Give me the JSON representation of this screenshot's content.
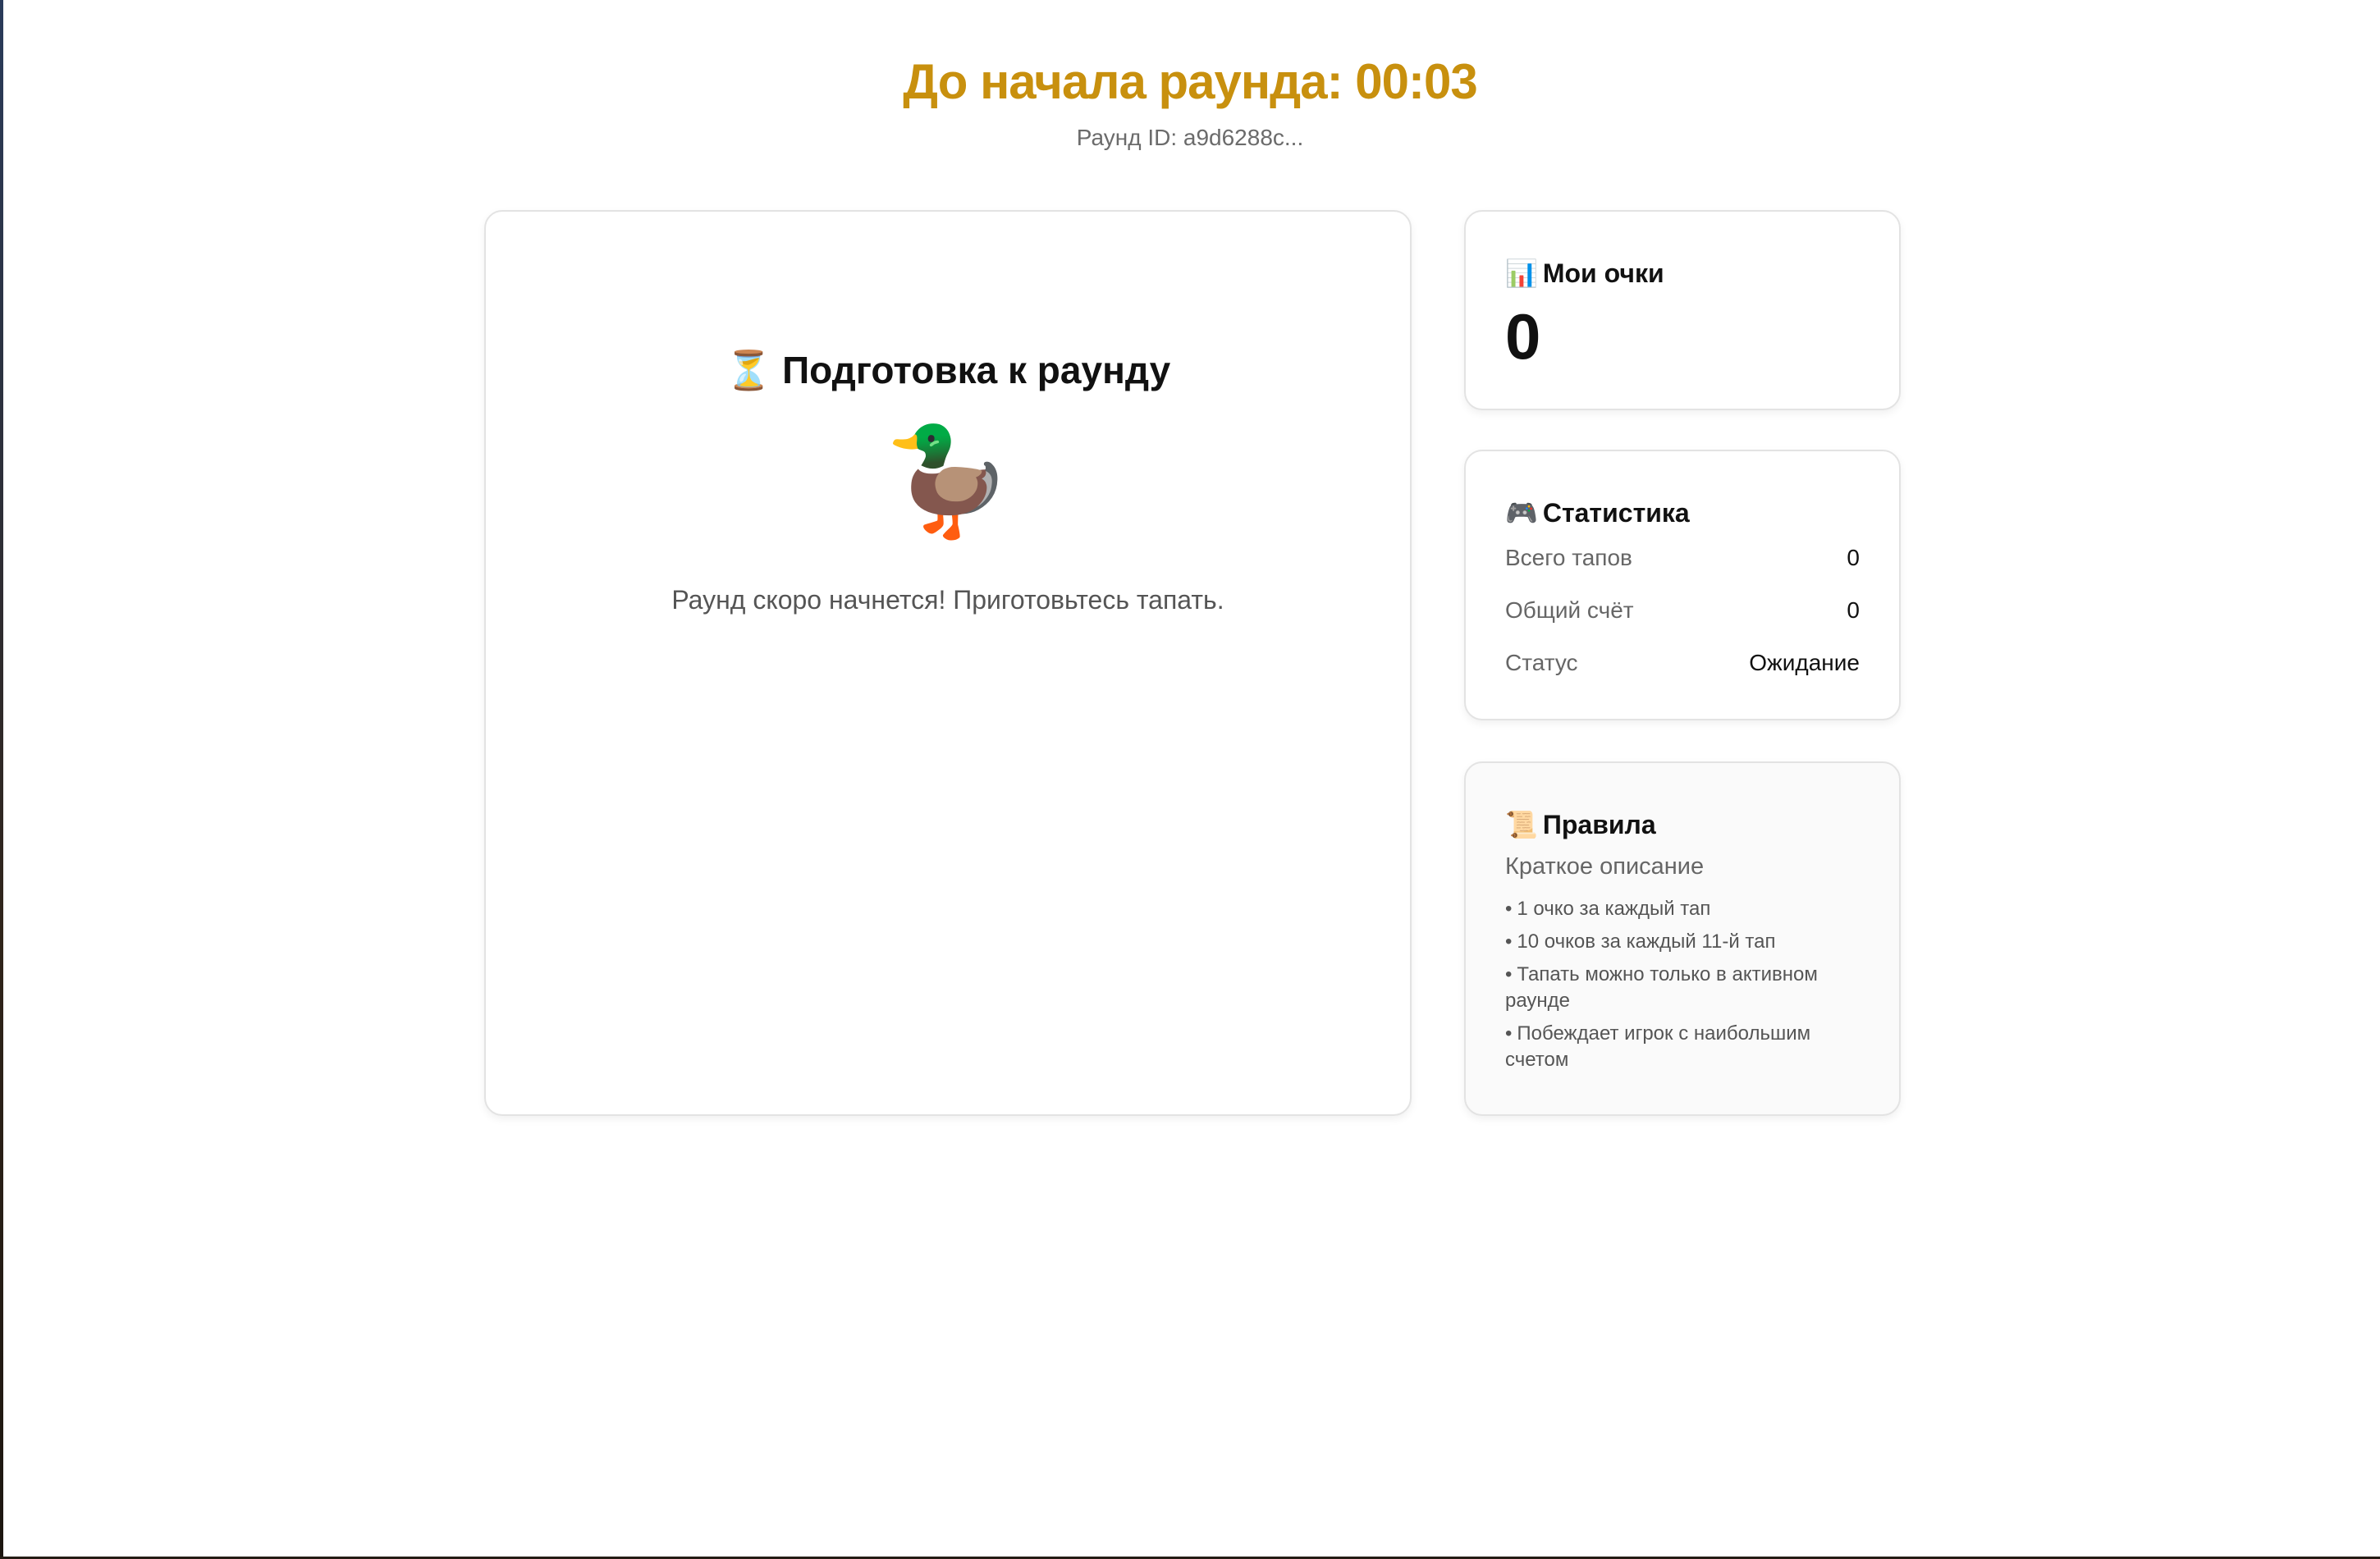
{
  "header": {
    "timer_title": "До начала раунда: 00:03",
    "round_id": "Раунд ID: a9d6288c..."
  },
  "main": {
    "title_emoji": "⏳",
    "title": "Подготовка к раунду",
    "image_emoji": "🦆",
    "message": "Раунд скоро начнется! Приготовьтесь тапать."
  },
  "score": {
    "title_emoji": "📊",
    "title": "Мои очки",
    "value": "0"
  },
  "stats": {
    "title_emoji": "🎮",
    "title": "Статистика",
    "rows": [
      {
        "label": "Всего тапов",
        "value": "0"
      },
      {
        "label": "Общий счёт",
        "value": "0"
      },
      {
        "label": "Статус",
        "value": "Ожидание"
      }
    ]
  },
  "rules": {
    "title_emoji": "📜",
    "title": "Правила",
    "subtitle": "Краткое описание",
    "bullet": "•",
    "items": [
      "1 очко за каждый тап",
      "10 очков за каждый 11-й тап",
      "Тапать можно только в активном раунде",
      "Побеждает игрок с наибольшим счетом"
    ]
  },
  "colors": {
    "accent": "#c8900e",
    "card_border": "#e3e3e3",
    "muted_text": "#666666"
  }
}
